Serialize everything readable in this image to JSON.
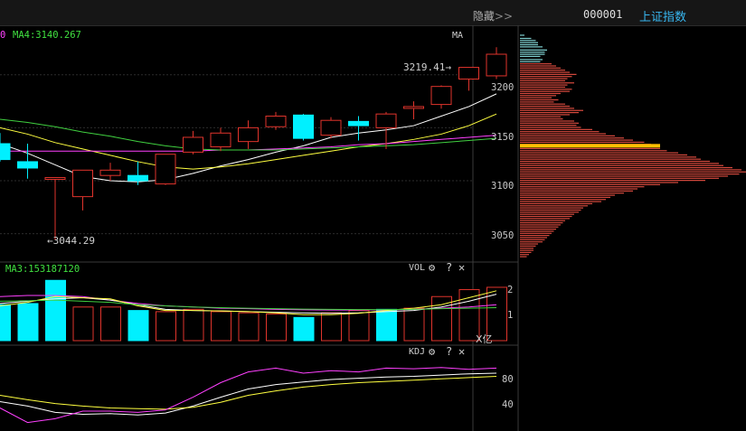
{
  "header": {
    "hide_label": "隐藏",
    "hide_arrow": ">>",
    "index_code": "000001",
    "index_name": "上证指数"
  },
  "main_chart": {
    "partial_legend": "0",
    "ma4_label": "MA4:3140.267",
    "indicator_tag": "MA",
    "high_label": "3219.41",
    "low_label": "3044.29",
    "arrow_right": "→",
    "arrow_left": "←",
    "price_ticks": [
      "3200",
      "3150",
      "3100",
      "3050"
    ]
  },
  "volume_panel": {
    "legend": "MA3:153187120",
    "name": "VOL",
    "unit": "X亿",
    "ticks": [
      "2",
      "1"
    ]
  },
  "kdj_panel": {
    "name": "KDJ",
    "ticks": [
      "80",
      "40"
    ]
  },
  "controls": {
    "gear": "⚙",
    "help": "?",
    "close": "✕"
  },
  "colors": {
    "up": "#e0342c",
    "down": "#00f0ff",
    "ma_white": "#ffffff",
    "ma_yellow": "#ffff40",
    "ma_magenta": "#ff40ff",
    "ma_green": "#40d040",
    "profile_upper": "#7ecfcf",
    "profile_lower": "#d84a3e",
    "profile_mark": "#ffc000",
    "index_name": "#38b7f0",
    "ma4_text": "#40e040"
  },
  "chart_data": {
    "type": "candlestick",
    "ylim": [
      3025,
      3245
    ],
    "candles": [
      {
        "o": 3135,
        "h": 3145,
        "c": 3120,
        "l": 3118
      },
      {
        "o": 3118,
        "h": 3135,
        "c": 3112,
        "l": 3102
      },
      {
        "o": 3103,
        "h": 3103,
        "c": 3103,
        "l": 3044.29
      },
      {
        "o": 3085,
        "h": 3110,
        "c": 3110,
        "l": 3072
      },
      {
        "o": 3105,
        "h": 3117,
        "c": 3110,
        "l": 3100
      },
      {
        "o": 3105,
        "h": 3118,
        "c": 3100,
        "l": 3096
      },
      {
        "o": 3097,
        "h": 3125,
        "c": 3125,
        "l": 3096
      },
      {
        "o": 3127,
        "h": 3147,
        "c": 3141,
        "l": 3125
      },
      {
        "o": 3132,
        "h": 3150,
        "c": 3145,
        "l": 3128
      },
      {
        "o": 3137,
        "h": 3157,
        "c": 3150,
        "l": 3130
      },
      {
        "o": 3151,
        "h": 3165,
        "c": 3161,
        "l": 3148
      },
      {
        "o": 3162,
        "h": 3163,
        "c": 3140,
        "l": 3138
      },
      {
        "o": 3143,
        "h": 3160,
        "c": 3157,
        "l": 3140
      },
      {
        "o": 3156,
        "h": 3161,
        "c": 3152,
        "l": 3138
      },
      {
        "o": 3150,
        "h": 3165,
        "c": 3163,
        "l": 3130
      },
      {
        "o": 3170,
        "h": 3175,
        "c": 3170,
        "l": 3158
      },
      {
        "o": 3172,
        "h": 3190,
        "c": 3189,
        "l": 3168
      },
      {
        "o": 3196,
        "h": 3205,
        "c": 3207,
        "l": 3185
      },
      {
        "o": 3199,
        "h": 3226,
        "c": 3219.41,
        "l": 3196
      }
    ],
    "ma_series": [
      {
        "color": "#ffffff",
        "values": [
          3135,
          3126,
          3115,
          3104,
          3100,
          3099,
          3101,
          3107,
          3114,
          3120,
          3127,
          3133,
          3141,
          3145,
          3148,
          3152,
          3161,
          3170,
          3182
        ]
      },
      {
        "color": "#ffff40",
        "values": [
          3150,
          3144,
          3136,
          3130,
          3124,
          3118,
          3113,
          3111,
          3113,
          3116,
          3120,
          3124,
          3128,
          3132,
          3135,
          3139,
          3144,
          3152,
          3163
        ]
      },
      {
        "color": "#ff40ff",
        "values": [
          3128,
          3128,
          3128,
          3128,
          3128,
          3128,
          3128,
          3128,
          3129,
          3129,
          3130,
          3131,
          3132,
          3134,
          3135,
          3137,
          3139,
          3141,
          3143
        ]
      },
      {
        "color": "#40d040",
        "values": [
          3158,
          3155,
          3151,
          3146,
          3142,
          3137,
          3133,
          3130,
          3129,
          3129,
          3129,
          3130,
          3131,
          3132,
          3133,
          3134,
          3136,
          3138,
          3140
        ]
      }
    ],
    "volume": {
      "ylim": [
        0,
        3.0
      ],
      "bars": [
        1.55,
        1.6,
        2.6,
        1.45,
        1.45,
        1.3,
        1.25,
        1.35,
        1.25,
        1.2,
        1.15,
        1.0,
        1.2,
        1.3,
        1.35,
        1.4,
        1.9,
        2.2,
        2.3
      ],
      "up": [
        false,
        false,
        false,
        true,
        true,
        false,
        true,
        true,
        true,
        true,
        true,
        false,
        true,
        true,
        false,
        true,
        true,
        true,
        true
      ],
      "ma_series": [
        {
          "color": "#ff40ff",
          "values": [
            1.9,
            1.95,
            1.95,
            1.9,
            1.75,
            1.6,
            1.5,
            1.45,
            1.4,
            1.38,
            1.35,
            1.33,
            1.32,
            1.32,
            1.33,
            1.35,
            1.4,
            1.45,
            1.55
          ]
        },
        {
          "color": "#ffffff",
          "values": [
            1.6,
            1.7,
            1.8,
            1.85,
            1.75,
            1.55,
            1.35,
            1.3,
            1.28,
            1.25,
            1.22,
            1.2,
            1.18,
            1.2,
            1.25,
            1.3,
            1.45,
            1.7,
            2.0
          ]
        },
        {
          "color": "#ffff40",
          "values": [
            1.5,
            1.65,
            1.9,
            1.85,
            1.8,
            1.5,
            1.3,
            1.3,
            1.28,
            1.25,
            1.2,
            1.12,
            1.12,
            1.18,
            1.3,
            1.4,
            1.55,
            1.85,
            2.15
          ]
        },
        {
          "color": "#40d040",
          "values": [
            1.7,
            1.72,
            1.75,
            1.7,
            1.65,
            1.55,
            1.5,
            1.45,
            1.42,
            1.4,
            1.38,
            1.36,
            1.35,
            1.34,
            1.34,
            1.35,
            1.38,
            1.4,
            1.42
          ]
        }
      ]
    },
    "kdj": {
      "ylim": [
        0,
        120
      ],
      "series": [
        {
          "color": "#ffffff",
          "values": [
            45,
            38,
            28,
            25,
            26,
            24,
            27,
            38,
            52,
            65,
            72,
            76,
            80,
            82,
            84,
            85,
            87,
            89,
            90
          ]
        },
        {
          "color": "#ffff40",
          "values": [
            55,
            48,
            42,
            38,
            35,
            34,
            33,
            36,
            44,
            55,
            62,
            68,
            72,
            75,
            77,
            79,
            81,
            83,
            85
          ]
        },
        {
          "color": "#ff40ff",
          "values": [
            35,
            12,
            18,
            30,
            30,
            28,
            32,
            52,
            75,
            92,
            98,
            90,
            94,
            92,
            98,
            97,
            99,
            96,
            98
          ]
        }
      ]
    },
    "profile": {
      "ylim": [
        3025,
        3245
      ],
      "mark_price": 3133,
      "bins": [
        [
          3237,
          2
        ],
        [
          3234,
          5
        ],
        [
          3232,
          7
        ],
        [
          3230,
          8
        ],
        [
          3228,
          8
        ],
        [
          3226,
          10
        ],
        [
          3223,
          12
        ],
        [
          3221,
          11
        ],
        [
          3219,
          11
        ],
        [
          3217,
          9
        ],
        [
          3214,
          10
        ],
        [
          3212,
          9
        ],
        [
          3210,
          14
        ],
        [
          3208,
          16
        ],
        [
          3206,
          18
        ],
        [
          3204,
          20
        ],
        [
          3202,
          22
        ],
        [
          3200,
          25
        ],
        [
          3198,
          23
        ],
        [
          3196,
          21
        ],
        [
          3194,
          20
        ],
        [
          3192,
          24
        ],
        [
          3190,
          21
        ],
        [
          3188,
          20
        ],
        [
          3186,
          23
        ],
        [
          3184,
          22
        ],
        [
          3182,
          18
        ],
        [
          3180,
          16
        ],
        [
          3178,
          14
        ],
        [
          3176,
          17
        ],
        [
          3174,
          15
        ],
        [
          3172,
          20
        ],
        [
          3170,
          22
        ],
        [
          3168,
          24
        ],
        [
          3166,
          28
        ],
        [
          3164,
          26
        ],
        [
          3162,
          22
        ],
        [
          3160,
          18
        ],
        [
          3158,
          19
        ],
        [
          3156,
          24
        ],
        [
          3154,
          26
        ],
        [
          3152,
          25
        ],
        [
          3150,
          27
        ],
        [
          3148,
          32
        ],
        [
          3146,
          35
        ],
        [
          3144,
          38
        ],
        [
          3142,
          42
        ],
        [
          3140,
          46
        ],
        [
          3138,
          50
        ],
        [
          3136,
          55
        ],
        [
          3134,
          58
        ],
        [
          3132,
          60
        ],
        [
          3130,
          62
        ],
        [
          3128,
          65
        ],
        [
          3126,
          70
        ],
        [
          3124,
          74
        ],
        [
          3122,
          78
        ],
        [
          3120,
          80
        ],
        [
          3118,
          84
        ],
        [
          3116,
          88
        ],
        [
          3114,
          90
        ],
        [
          3112,
          94
        ],
        [
          3110,
          98
        ],
        [
          3108,
          100
        ],
        [
          3106,
          97
        ],
        [
          3104,
          92
        ],
        [
          3102,
          88
        ],
        [
          3100,
          82
        ],
        [
          3098,
          70
        ],
        [
          3096,
          62
        ],
        [
          3094,
          55
        ],
        [
          3092,
          52
        ],
        [
          3090,
          50
        ],
        [
          3088,
          46
        ],
        [
          3086,
          42
        ],
        [
          3084,
          40
        ],
        [
          3082,
          38
        ],
        [
          3080,
          36
        ],
        [
          3078,
          32
        ],
        [
          3076,
          30
        ],
        [
          3074,
          28
        ],
        [
          3072,
          27
        ],
        [
          3070,
          26
        ],
        [
          3068,
          24
        ],
        [
          3066,
          23
        ],
        [
          3064,
          22
        ],
        [
          3062,
          20
        ],
        [
          3060,
          19
        ],
        [
          3058,
          18
        ],
        [
          3056,
          17
        ],
        [
          3054,
          16
        ],
        [
          3052,
          15
        ],
        [
          3050,
          14
        ],
        [
          3048,
          13
        ],
        [
          3046,
          12
        ],
        [
          3044,
          11
        ],
        [
          3042,
          10
        ],
        [
          3040,
          8
        ],
        [
          3038,
          7
        ],
        [
          3036,
          6
        ],
        [
          3034,
          6
        ],
        [
          3032,
          5
        ],
        [
          3030,
          4
        ],
        [
          3028,
          3
        ]
      ]
    }
  }
}
